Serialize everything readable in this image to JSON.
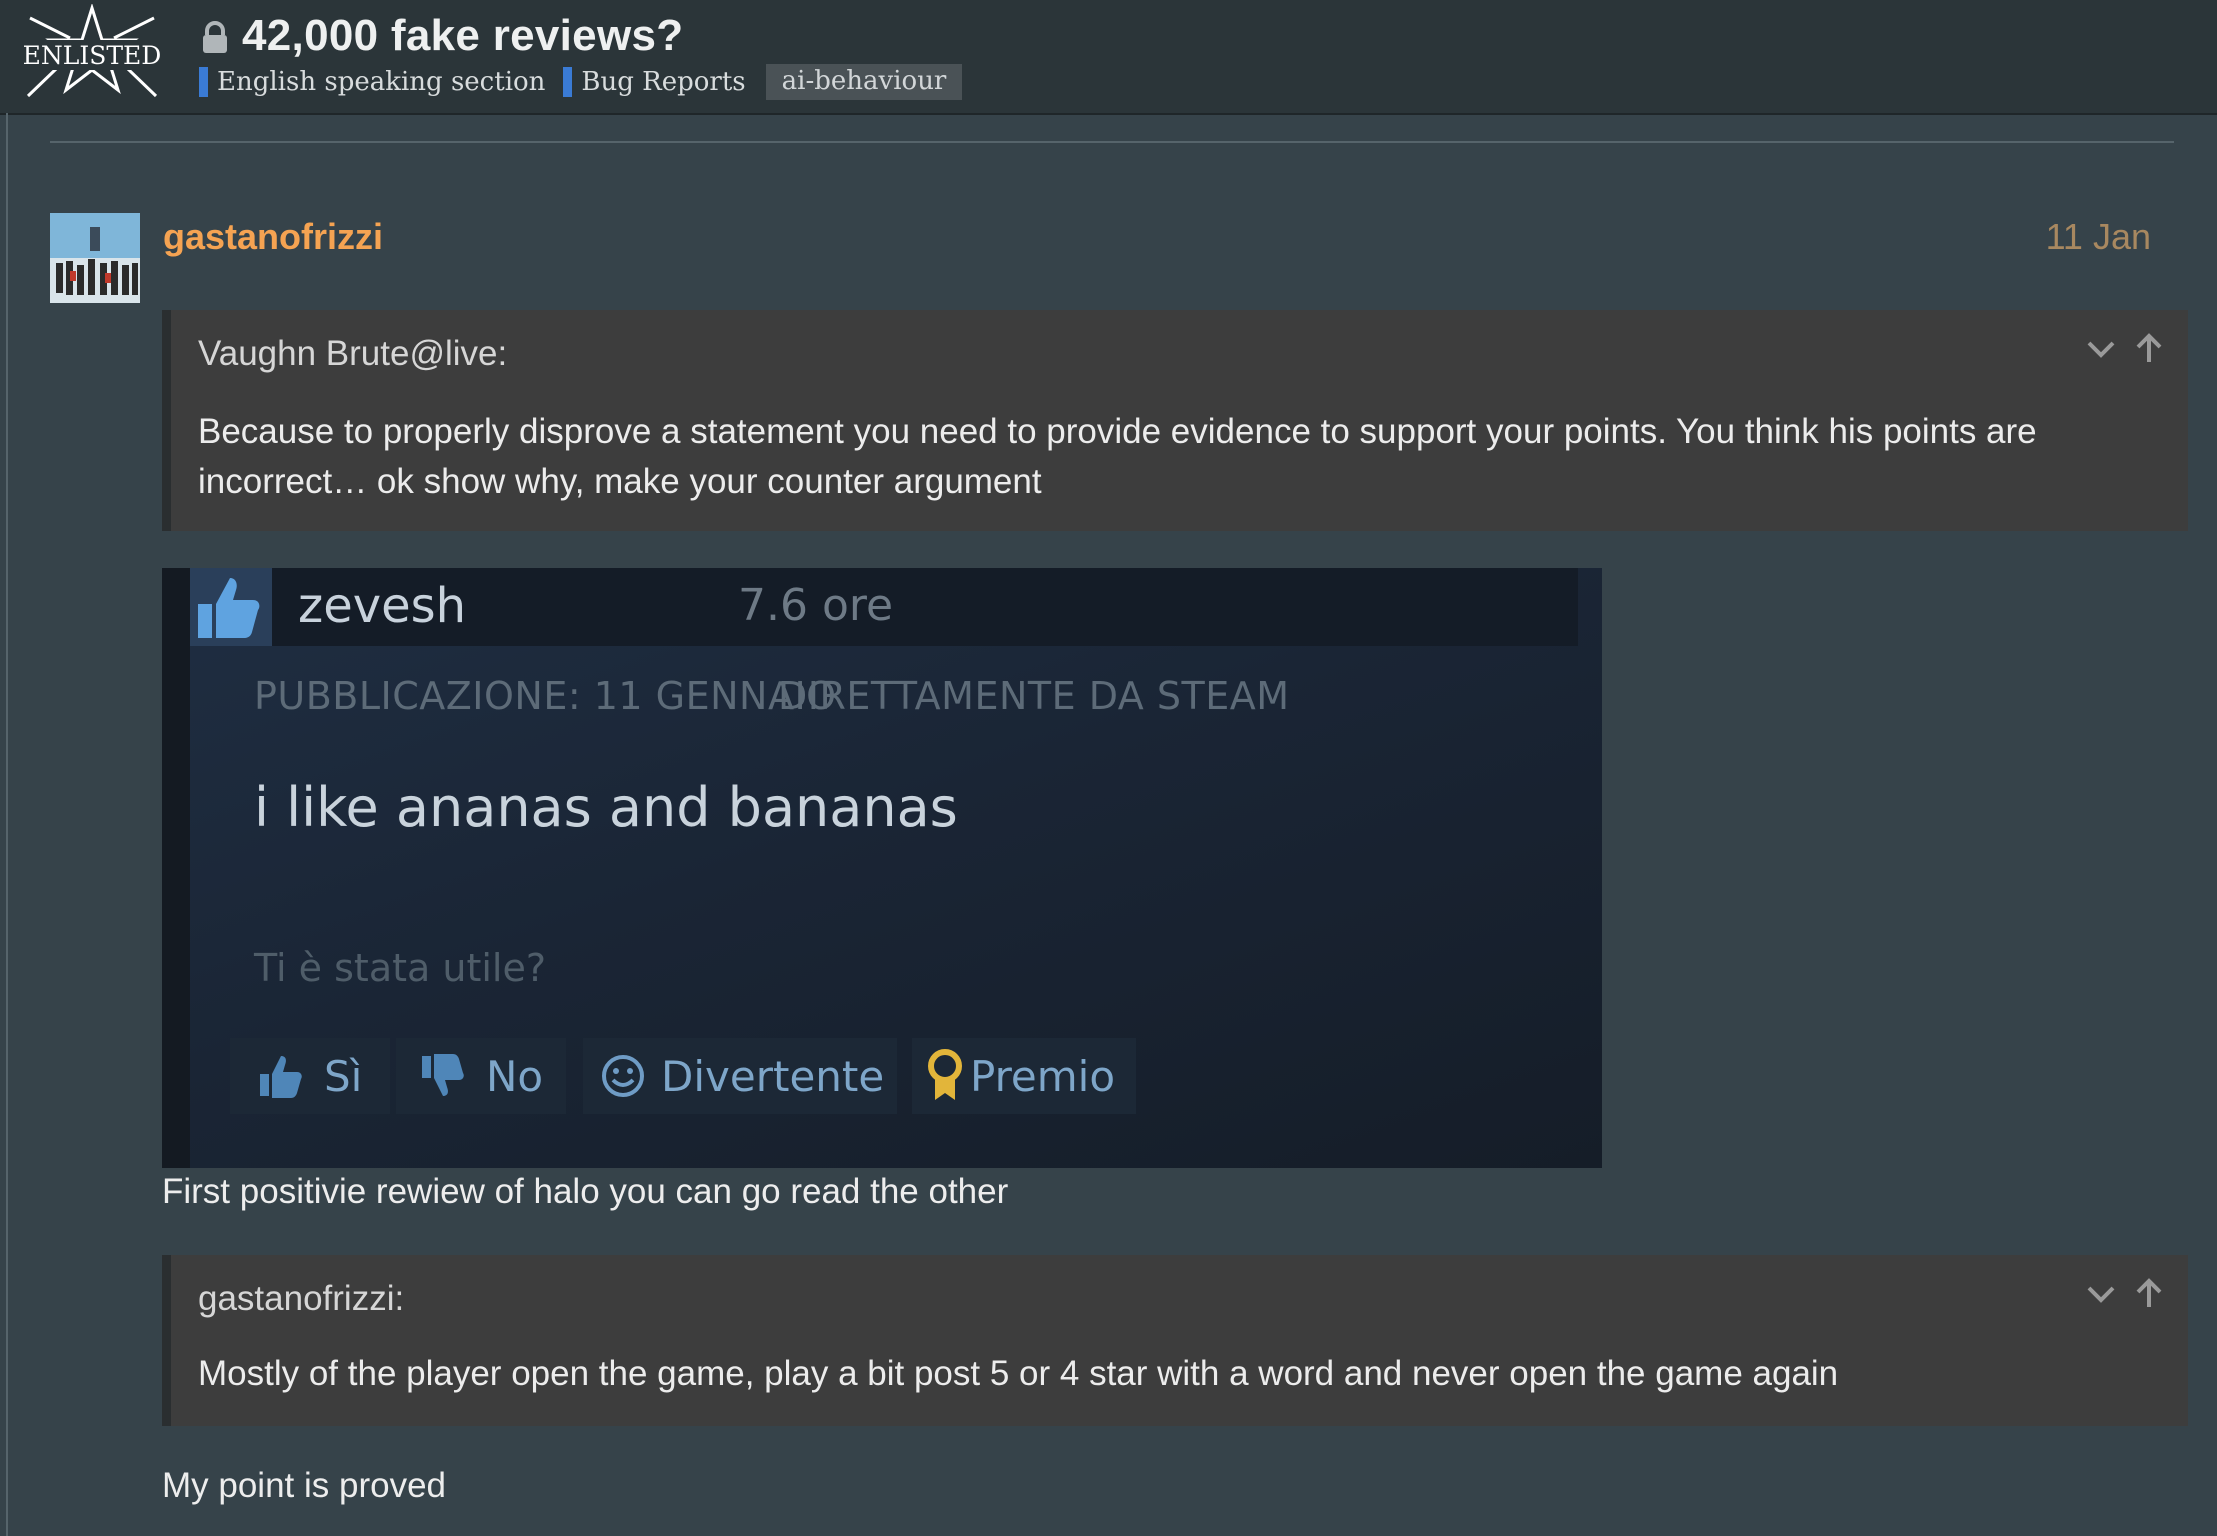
{
  "header": {
    "logo_text": "ENLISTED",
    "topic_title": "42,000 fake reviews?",
    "categories": [
      {
        "label": "English speaking section",
        "color": "#3a7bd5"
      },
      {
        "label": "Bug Reports",
        "color": "#3a7bd5"
      }
    ],
    "tag": "ai-behaviour"
  },
  "post": {
    "username": "gastanofrizzi",
    "date": "11 Jan",
    "quote1": {
      "author": "Vaughn Brute@live:",
      "text": "Because to properly disprove a statement you need to provide evidence to support your points. You think his points are incorrect… ok show why, make your counter argument"
    },
    "embedded_review": {
      "reviewer": "zevesh",
      "hours": "7.6 ore",
      "published": "PUBBLICAZIONE: 11 GENNAIO",
      "source": "DIRETTAMENTE DA STEAM",
      "review_text": "i like ananas and bananas",
      "helpful_question": "Ti è stata utile?",
      "buttons": {
        "yes": "Sì",
        "no": "No",
        "funny": "Divertente",
        "award": "Premio"
      }
    },
    "text1": "First positivie rewiew of halo you can go read the other",
    "quote2": {
      "author": "gastanofrizzi:",
      "text": "Mostly of the player open the game, play a bit post 5 or 4 star with a word and never open the game again"
    },
    "text2": "My point is proved"
  },
  "colors": {
    "background": "#36434a",
    "header": "#2b3539",
    "username": "#f5a352",
    "quote_bg": "#3d3d3d"
  }
}
